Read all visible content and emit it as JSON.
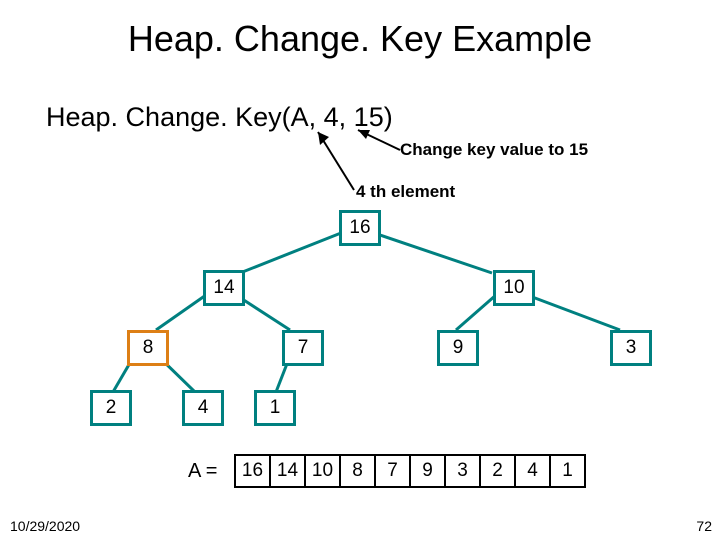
{
  "title": "Heap. Change. Key Example",
  "call_text": "Heap. Change. Key(A, 4, 15)",
  "anno": {
    "change": "Change key value to 15",
    "fourth": "4 th element"
  },
  "tree": {
    "n1": "16",
    "n2": "14",
    "n3": "10",
    "n4": "8",
    "n5": "7",
    "n6": "9",
    "n7": "3",
    "n8": "2",
    "n9": "4",
    "n10": "1"
  },
  "array_label": "A =",
  "array": [
    "16",
    "14",
    "10",
    "8",
    "7",
    "9",
    "3",
    "2",
    "4",
    "1"
  ],
  "footer": {
    "date": "10/29/2020",
    "page": "72"
  },
  "chart_data": {
    "type": "table",
    "title": "Binary max-heap before HeapChangeKey(A,4,15)",
    "heap_array": [
      16,
      14,
      10,
      8,
      7,
      9,
      3,
      2,
      4,
      1
    ],
    "operation": {
      "name": "HeapChangeKey",
      "index": 4,
      "new_key": 15
    },
    "highlight_index": 4
  }
}
